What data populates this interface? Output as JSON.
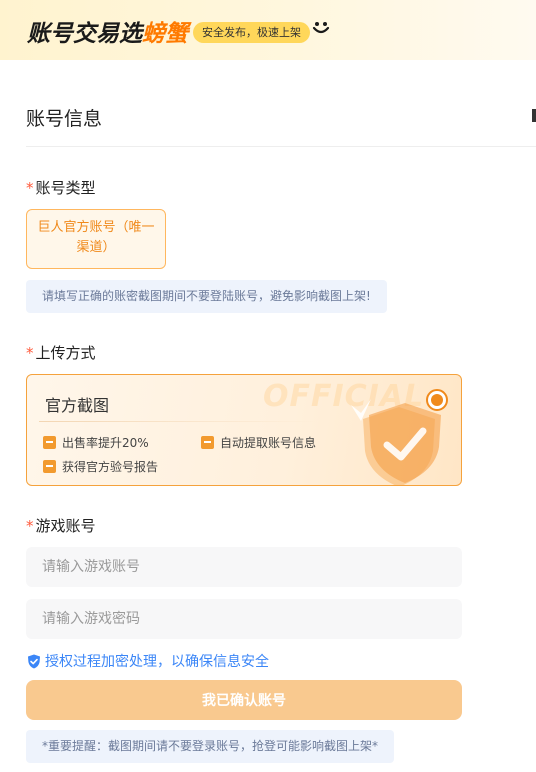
{
  "banner": {
    "brand": "账号交易选",
    "brand_accent": "螃蟹",
    "slogan": "安全发布，极速上架"
  },
  "section": {
    "title": "账号信息"
  },
  "account_type": {
    "required_mark": "*",
    "label": "账号类型",
    "options": [
      {
        "label": "巨人官方账号（唯一渠道）",
        "selected": true
      }
    ],
    "tip": "请填写正确的账密截图期间不要登陆账号，避免影响截图上架!"
  },
  "upload_method": {
    "required_mark": "*",
    "label": "上传方式",
    "card": {
      "title": "官方截图",
      "watermark": "OFFICIAL",
      "selected": true,
      "features": [
        "出售率提升20%",
        "自动提取账号信息",
        "获得官方验号报告"
      ]
    }
  },
  "game_account": {
    "required_mark": "*",
    "label": "游戏账号",
    "account_input": {
      "placeholder": "请输入游戏账号",
      "value": ""
    },
    "password_input": {
      "placeholder": "请输入游戏密码",
      "value": ""
    },
    "security_note": "授权过程加密处理，以确保信息安全"
  },
  "confirm_button": {
    "label": "我已确认账号"
  },
  "footer_tip": "*重要提醒：截图期间请不要登录账号，抢登可能影响截图上架*",
  "colors": {
    "accent": "#f08a1c",
    "required": "#ff5a3c",
    "link_blue": "#3b86f7",
    "button_disabled": "#f9c98f",
    "tip_bg": "#eef3fc"
  }
}
